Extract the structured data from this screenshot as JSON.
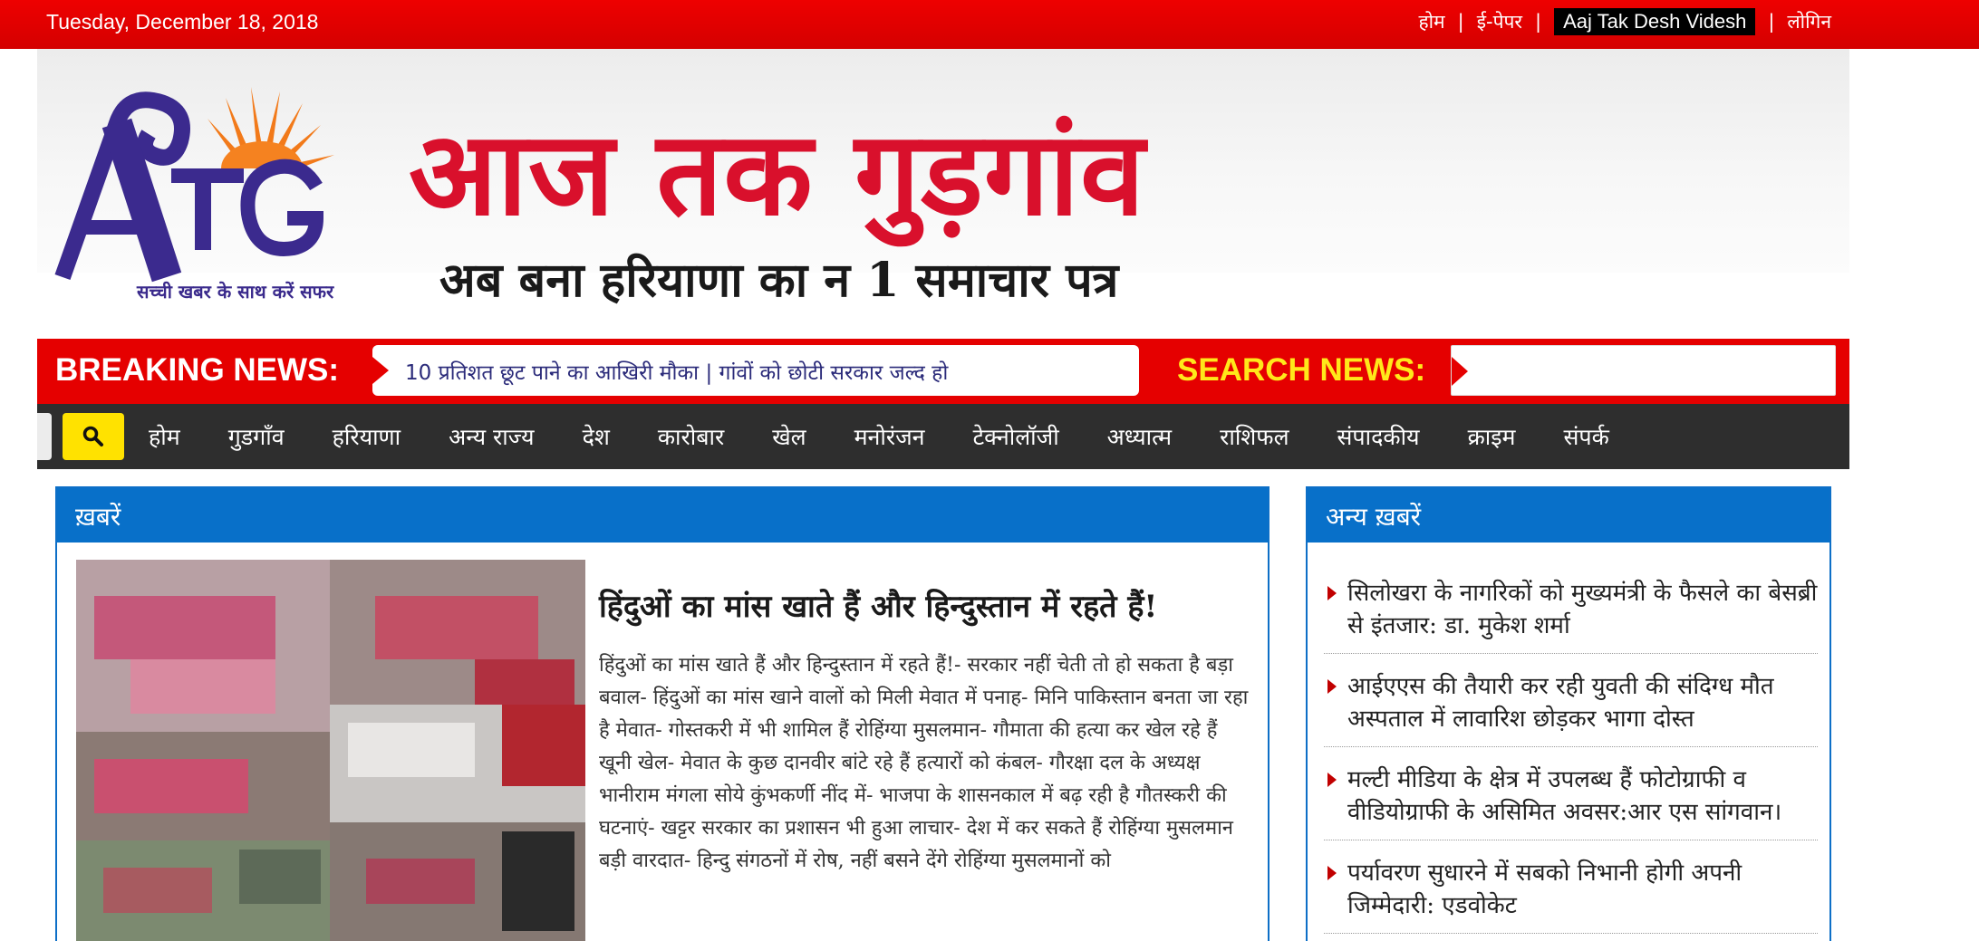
{
  "topbar": {
    "date": "Tuesday, December 18, 2018",
    "links": [
      {
        "label": "होम"
      },
      {
        "label": "ई-पेपर"
      },
      {
        "label": "Aaj Tak Desh Videsh"
      },
      {
        "label": "लोगिन"
      }
    ],
    "separator": "|"
  },
  "header": {
    "logo_letters": "ATG",
    "logo_tagline": "सच्ची खबर के साथ करें सफर",
    "title": "आज तक गुड़गांव",
    "subtitle": "अब बना हरियाणा का न 1 समाचार पत्र"
  },
  "breaking": {
    "label": "BREAKING NEWS:",
    "ticker": "10 प्रतिशत छूट पाने का आखिरी मौका  |  गांवों को छोटी सरकार जल्द हो",
    "search_label": "SEARCH NEWS:",
    "search_value": ""
  },
  "nav": {
    "items": [
      "होम",
      "गुडगाँव",
      "हरियाणा",
      "अन्य राज्य",
      "देश",
      "कारोबार",
      "खेल",
      "मनोरंजन",
      "टेक्नोलॉजी",
      "अध्यात्म",
      "राशिफल",
      "संपादकीय",
      "क्राइम",
      "संपर्क"
    ]
  },
  "main": {
    "heading": "ख़बरें",
    "article": {
      "title": "हिंदुओं का मांस खाते हैं और हिन्दुस्तान में रहते हैं!",
      "body": "हिंदुओं का मांस खाते हैं और हिन्दुस्तान में रहते हैं!- सरकार नहीं चेती तो हो सकता है बड़ा बवाल- हिंदुओं का मांस खाने वालों को मिली मेवात में पनाह- मिनि पाकिस्तान बनता जा रहा है मेवात- गोस्तकरी में भी शामिल हैं रोहिंग्या मुसलमान- गौमाता की हत्या कर खेल रहे हैं खूनी खेल- मेवात के कुछ दानवीर बांटे रहे हैं हत्यारों को कंबल- गौरक्षा दल के अध्यक्ष भानीराम मंगला सोये कुंभकर्णी नींद में- भाजपा के शासनकाल में बढ़ रही है गौतस्करी की घटनाएं- खट्टर सरकार का प्रशासन भी हुआ लाचार- देश में कर सकते हैं रोहिंग्या मुसलमान बड़ी वारदात- हिन्दु संगठनों में रोष, नहीं बसने देंगे रोहिंग्या मुसलमानों को"
    }
  },
  "sidebar": {
    "heading": "अन्य ख़बरें",
    "items": [
      "सिलोखरा के नागरिकों को मुख्यमंत्री के फैसले का बेसब्री से इंतजार: डा. मुकेश शर्मा",
      "आईएएस की तैयारी कर रही युवती की संदिग्ध मौत अस्पताल में लावारिश छोड़कर भागा दोस्त",
      "मल्टी मीडिया के क्षेत्र में उपलब्ध हैं फोटोग्राफी व वीडियोग्राफी के असिमित अवसर:आर एस सांगवान।",
      "पर्यावरण सुधारने में सबको निभानी होगी अपनी जिम्मेदारी: एडवोकेट"
    ]
  },
  "colors": {
    "topbar_red": "#e00000",
    "title_red": "#d9102c",
    "panel_blue": "#0870c9",
    "nav_dark": "#2e2e2e",
    "search_yellow": "#ffe200"
  }
}
